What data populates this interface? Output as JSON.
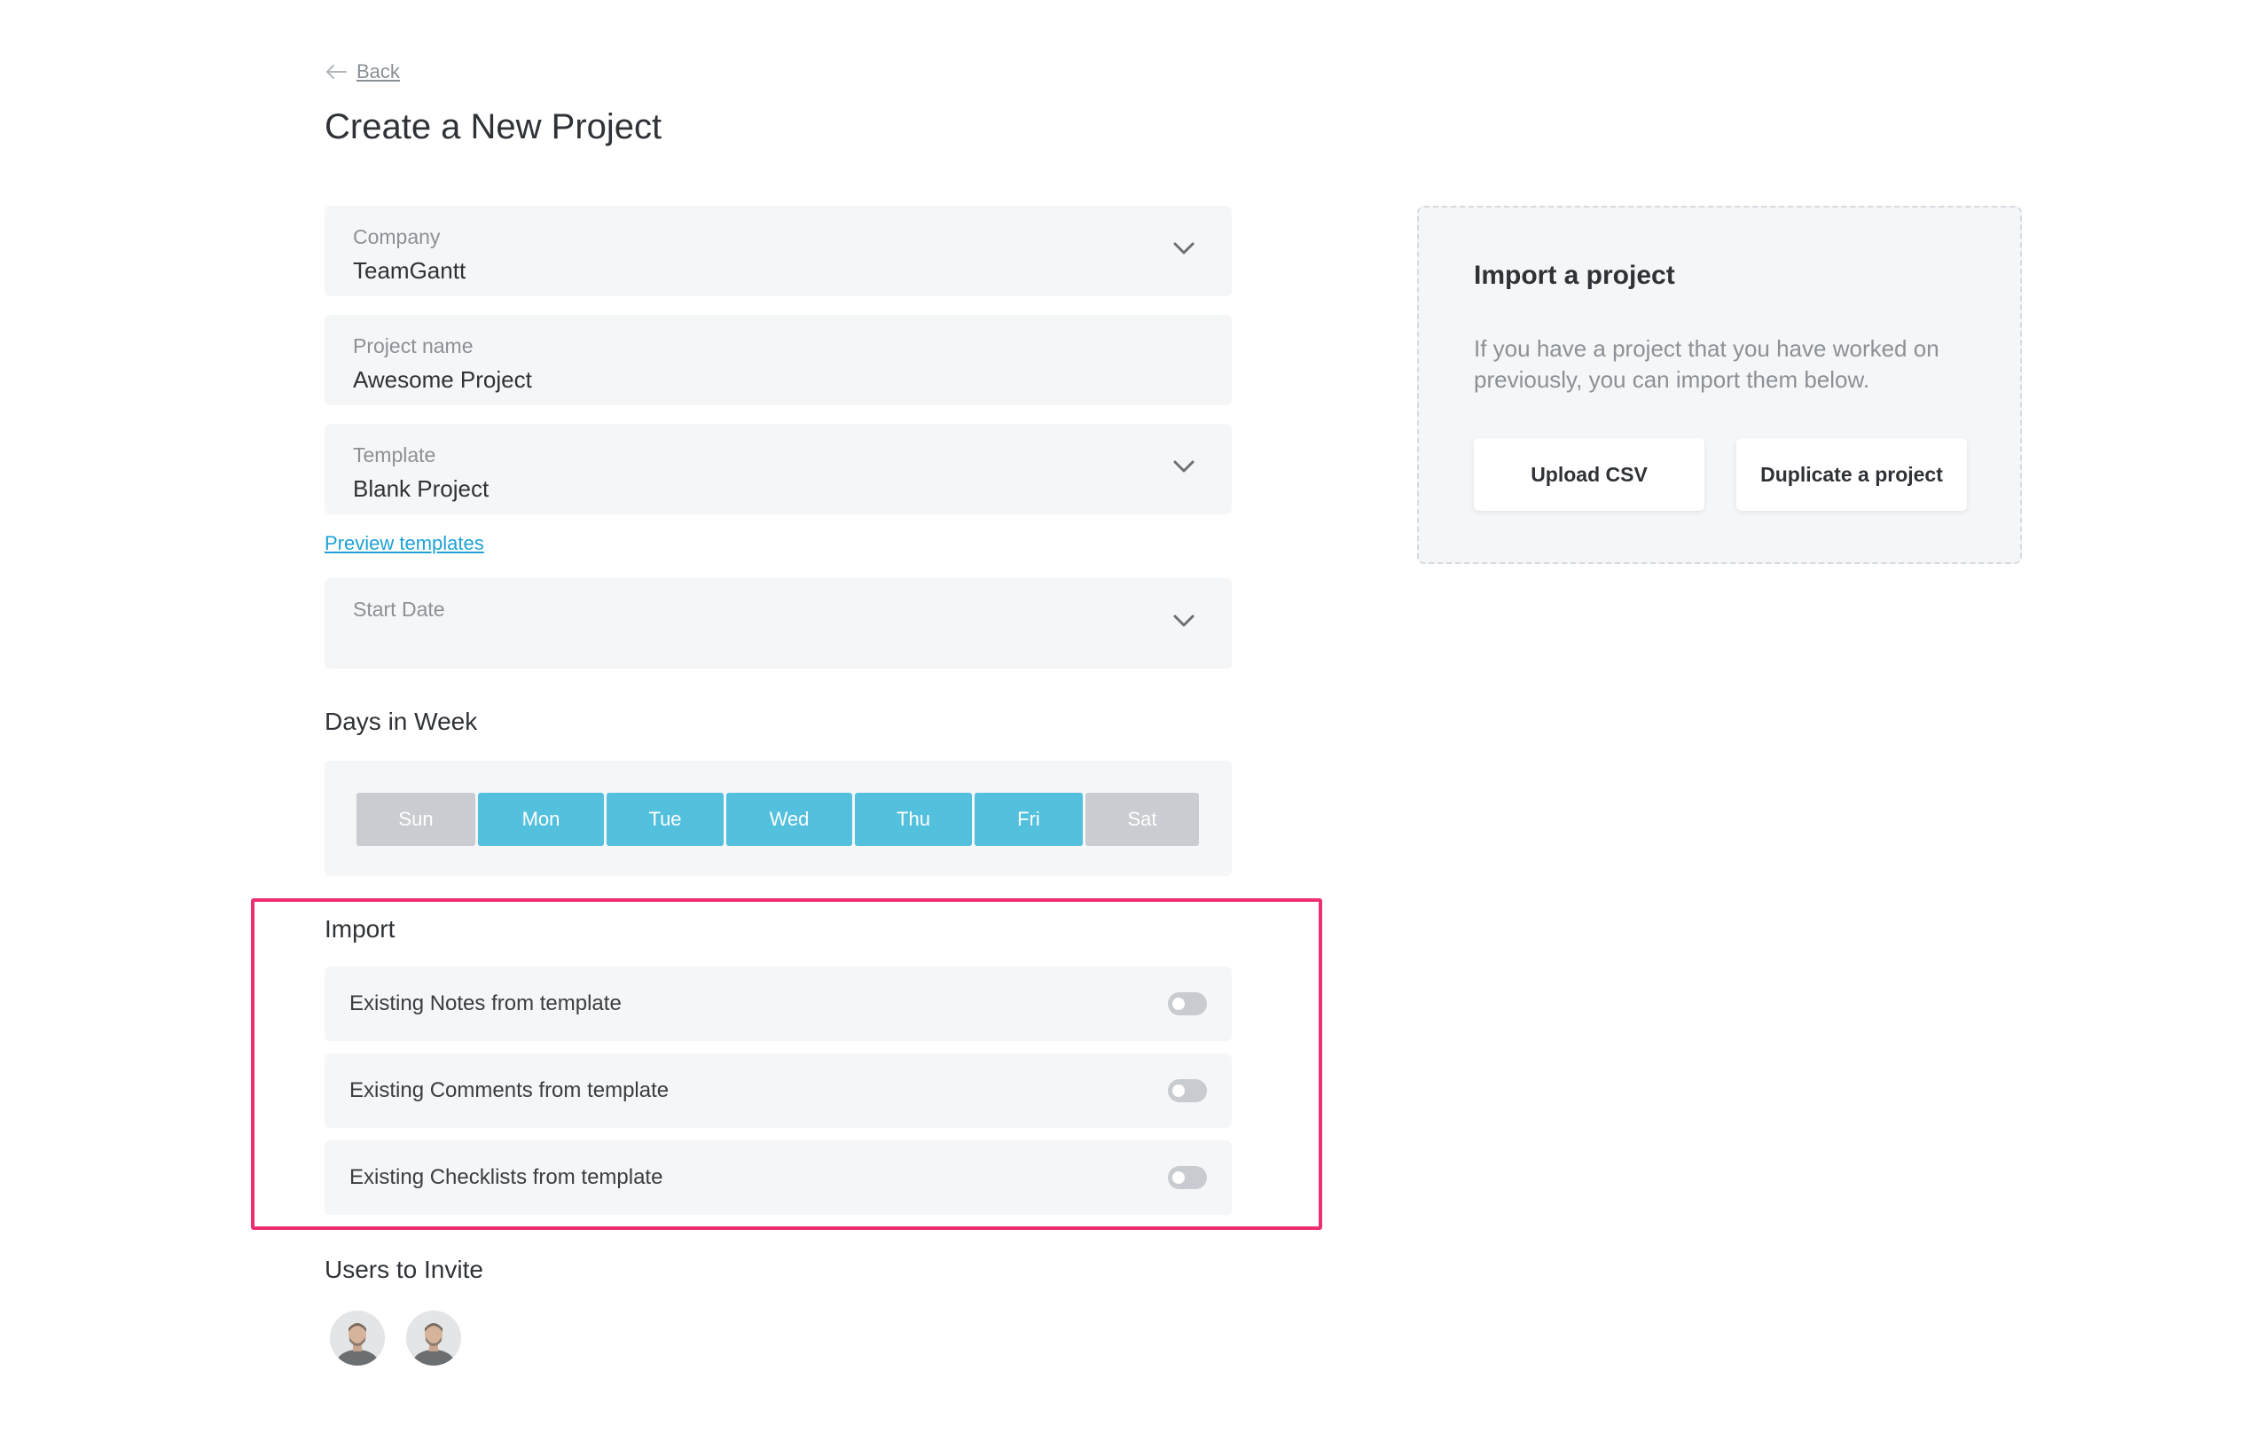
{
  "back_label": "Back",
  "page_title": "Create a New Project",
  "fields": {
    "company": {
      "label": "Company",
      "value": "TeamGantt"
    },
    "project_name": {
      "label": "Project name",
      "value": "Awesome Project"
    },
    "template": {
      "label": "Template",
      "value": "Blank Project"
    },
    "start_date": {
      "label": "Start Date",
      "value": ""
    }
  },
  "preview_templates": "Preview templates",
  "days_section": {
    "title": "Days in Week",
    "days": [
      {
        "label": "Sun",
        "selected": false
      },
      {
        "label": "Mon",
        "selected": true
      },
      {
        "label": "Tue",
        "selected": true
      },
      {
        "label": "Wed",
        "selected": true
      },
      {
        "label": "Thu",
        "selected": true
      },
      {
        "label": "Fri",
        "selected": true
      },
      {
        "label": "Sat",
        "selected": false
      }
    ]
  },
  "import_section": {
    "title": "Import",
    "options": [
      {
        "label": "Existing Notes from template",
        "enabled": false
      },
      {
        "label": "Existing Comments from template",
        "enabled": false
      },
      {
        "label": "Existing Checklists from template",
        "enabled": false
      }
    ]
  },
  "users_section": {
    "title": "Users to Invite"
  },
  "import_panel": {
    "title": "Import a project",
    "description": "If you have a project that you have worked on previously, you can import them below.",
    "upload_label": "Upload CSV",
    "duplicate_label": "Duplicate a project"
  },
  "colors": {
    "accent": "#53c0dd",
    "link": "#1ea2d5",
    "highlight": "#ee2f6f",
    "field_bg": "#f4f6f8"
  }
}
